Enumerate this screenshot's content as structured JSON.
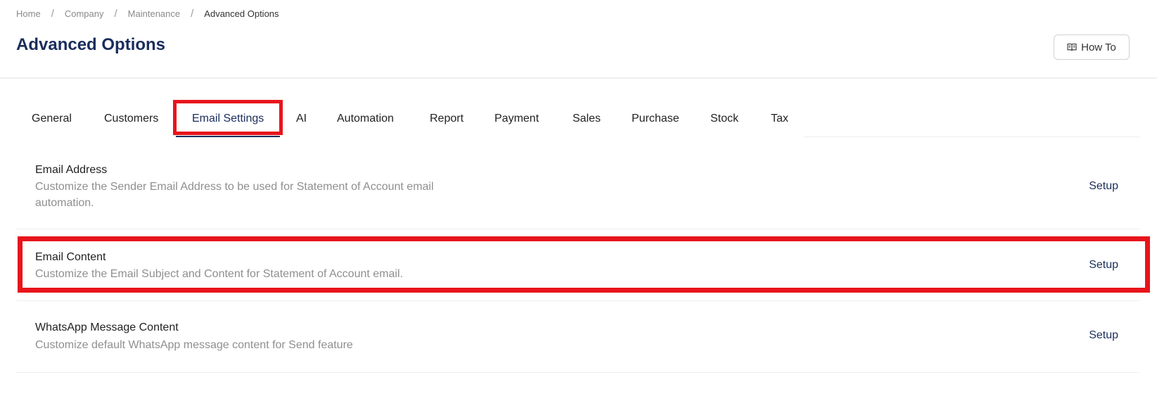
{
  "breadcrumb": {
    "items": [
      "Home",
      "Company",
      "Maintenance",
      "Advanced Options"
    ],
    "separator": "/"
  },
  "header": {
    "title": "Advanced Options",
    "how_to_label": "How To",
    "how_to_icon": "book-open-icon"
  },
  "tabs": [
    {
      "label": "General"
    },
    {
      "label": "Customers"
    },
    {
      "label": "Email Settings",
      "active": true
    },
    {
      "label": "AI"
    },
    {
      "label": "Automation"
    },
    {
      "label": "Report"
    },
    {
      "label": "Payment"
    },
    {
      "label": "Sales"
    },
    {
      "label": "Purchase"
    },
    {
      "label": "Stock"
    },
    {
      "label": "Tax"
    }
  ],
  "settings": [
    {
      "title": "Email Address",
      "description": "Customize the Sender Email Address to be used for Statement of Account email automation.",
      "action": "Setup"
    },
    {
      "title": "Email Content",
      "description": "Customize the Email Subject and Content for Statement of Account email.",
      "action": "Setup"
    },
    {
      "title": "WhatsApp Message Content",
      "description": "Customize default WhatsApp message content for Send feature",
      "action": "Setup"
    }
  ],
  "colors": {
    "title": "#1a2d5c",
    "highlight": "#e8141b",
    "muted_text": "#8f8f8f"
  }
}
